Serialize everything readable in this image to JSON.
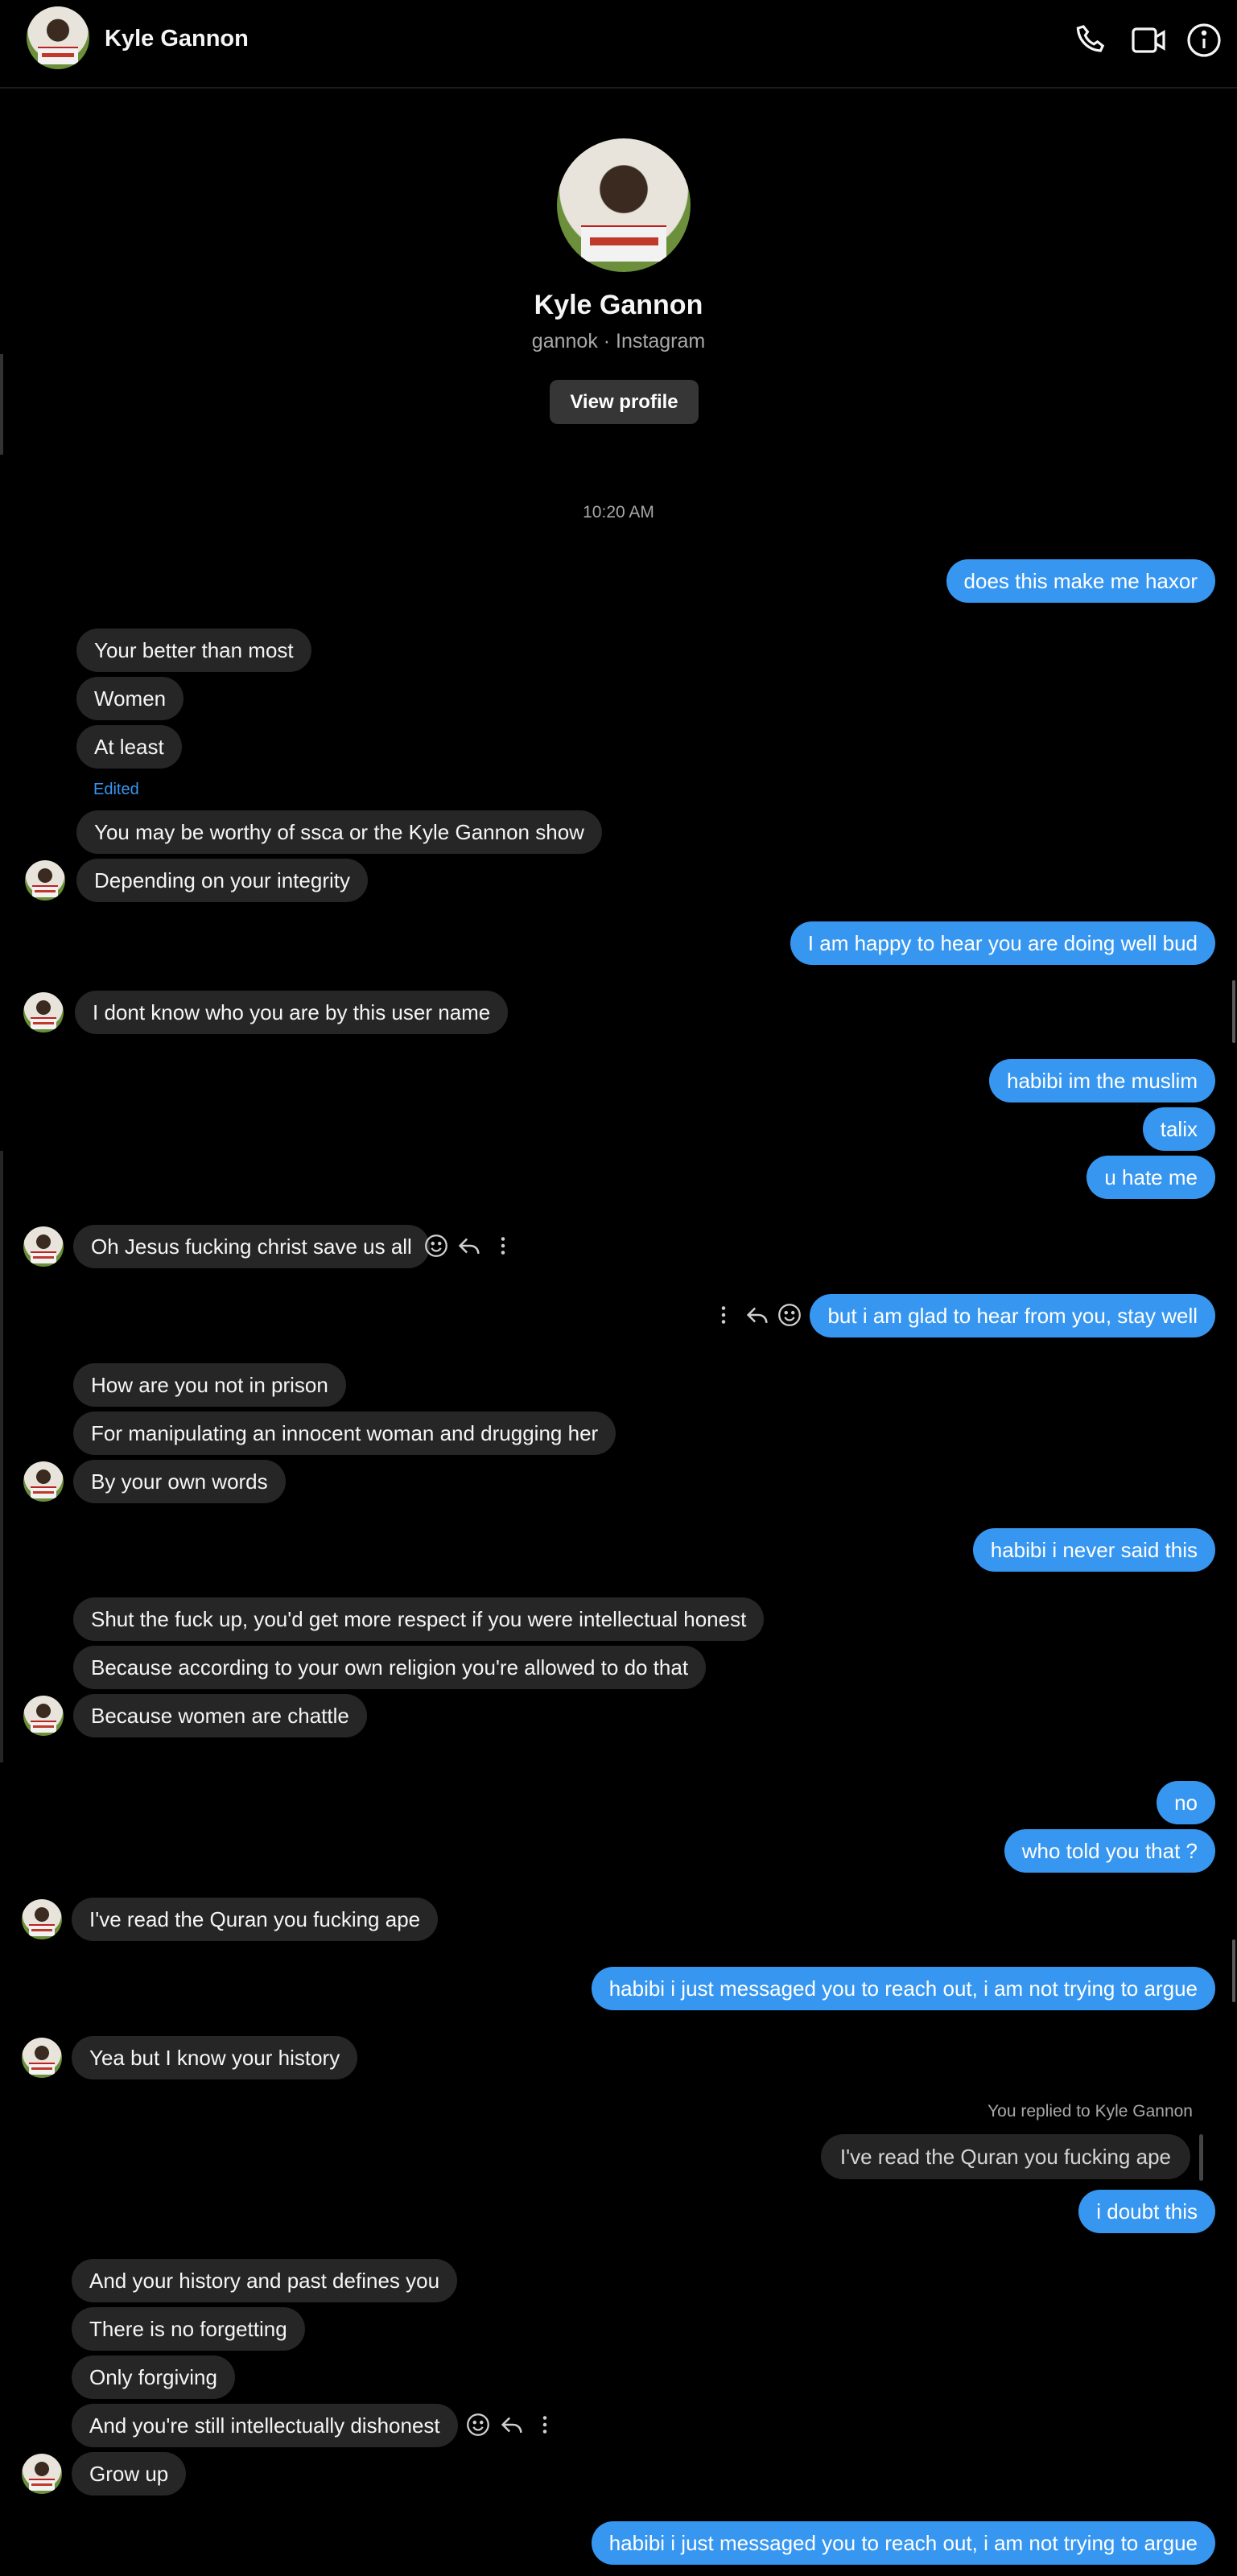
{
  "header": {
    "name": "Kyle Gannon"
  },
  "profile": {
    "name": "Kyle Gannon",
    "sub": "gannok · Instagram",
    "view_profile": "View profile"
  },
  "timestamp": "10:20 AM",
  "edited_label": "Edited",
  "reply": {
    "meta": "You replied to Kyle Gannon",
    "quoted": "I've read the Quran you fucking ape"
  },
  "messages": [
    "does this make me haxor",
    "Your better than most",
    "Women",
    "At least",
    "You may be worthy of ssca or the Kyle Gannon show",
    "Depending on your integrity",
    "I am happy to hear you are doing well bud",
    "I dont know who you are by this user name",
    "habibi im the muslim",
    "talix",
    "u hate me",
    "Oh Jesus fucking christ save us all",
    "but i am glad to hear from you, stay well",
    "How are you not in prison",
    "For manipulating an innocent woman and drugging her",
    "By your own words",
    "habibi i never said this",
    "Shut the fuck up, you'd get more respect if you were intellectual honest",
    "Because according to your own religion you're allowed to do that",
    "Because women are chattle",
    "no",
    "who told you that ?",
    "I've read the Quran you fucking ape",
    "habibi i just messaged you to reach out, i am not trying to argue",
    "Yea but I know your history",
    "i doubt this",
    "And your history and past defines you",
    "There is no forgetting",
    "Only forgiving",
    "And you're still intellectually dishonest",
    "Grow up",
    "habibi i just messaged you to reach out, i am not trying to argue"
  ]
}
